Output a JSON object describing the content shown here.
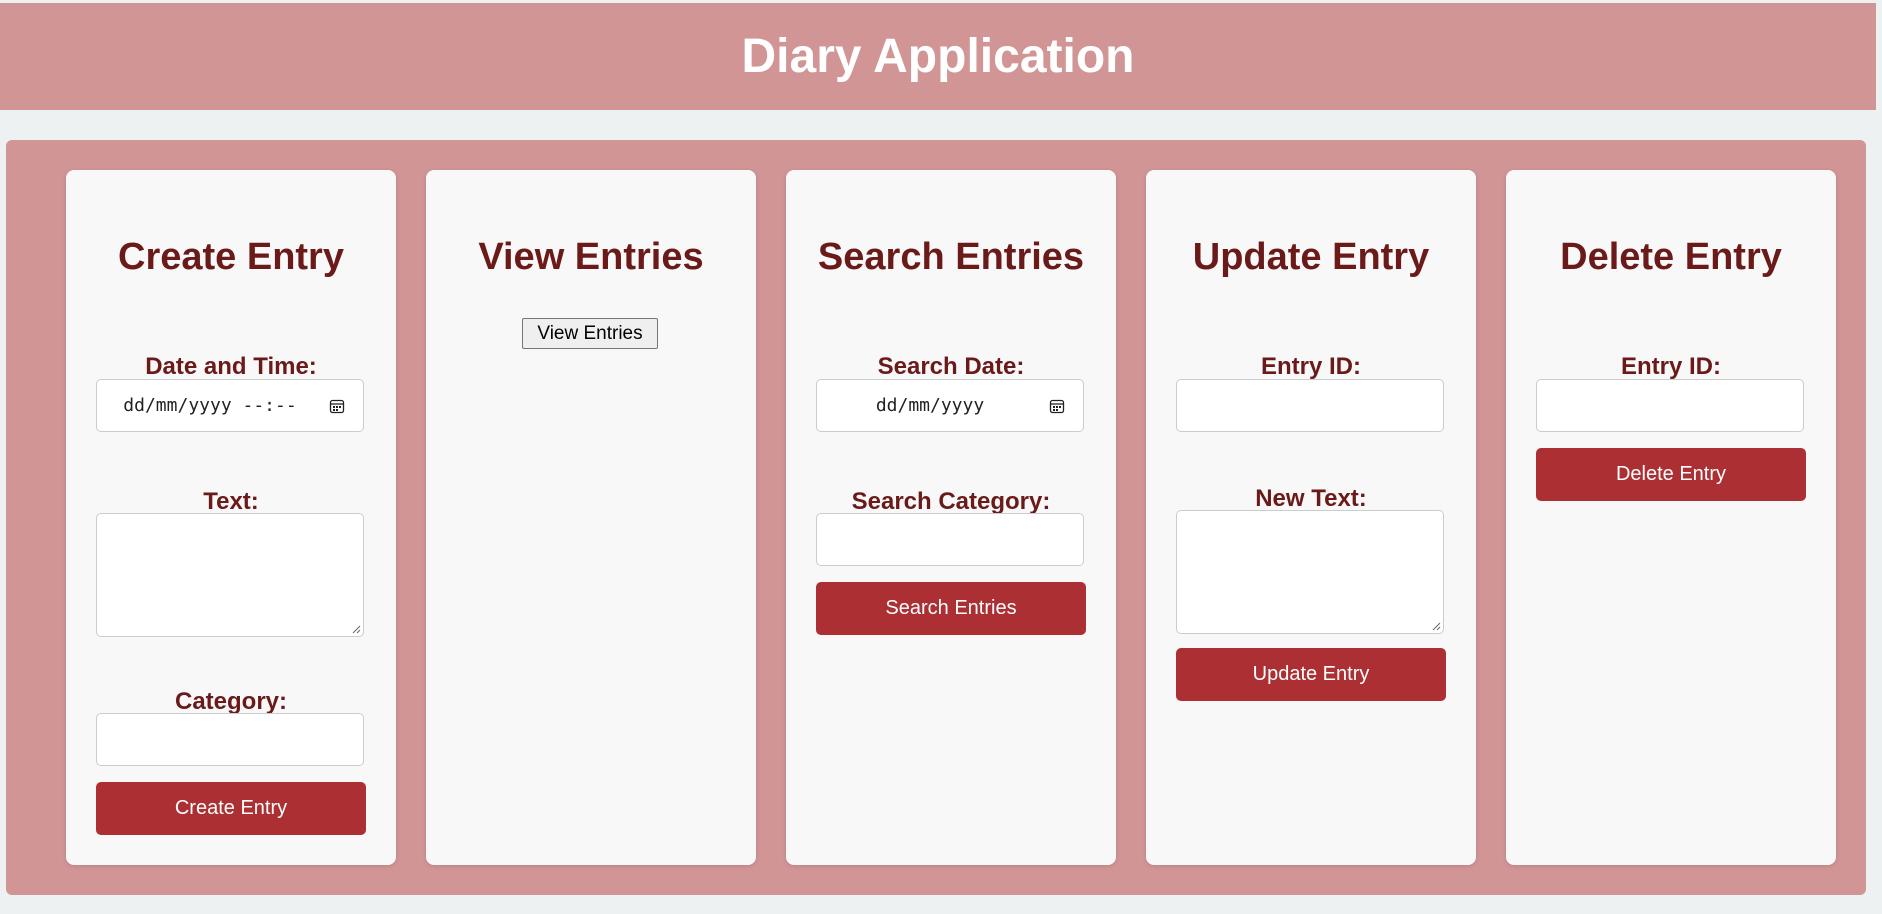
{
  "app": {
    "title": "Diary Application"
  },
  "create": {
    "heading": "Create Entry",
    "datetime_label": "Date and Time:",
    "datetime_placeholder": "dd/mm/yyyy --:--",
    "text_label": "Text:",
    "text_value": "",
    "category_label": "Category:",
    "category_value": "",
    "button": "Create Entry"
  },
  "view": {
    "heading": "View Entries",
    "button": "View Entries"
  },
  "search": {
    "heading": "Search Entries",
    "date_label": "Search Date:",
    "date_placeholder": "dd/mm/yyyy",
    "category_label": "Search Category:",
    "category_value": "",
    "button": "Search Entries"
  },
  "update": {
    "heading": "Update Entry",
    "id_label": "Entry ID:",
    "id_value": "",
    "text_label": "New Text:",
    "text_value": "",
    "button": "Update Entry"
  },
  "delete": {
    "heading": "Delete Entry",
    "id_label": "Entry ID:",
    "id_value": "",
    "button": "Delete Entry"
  },
  "icons": {
    "datetime_picker": "calendar-icon",
    "date_picker": "calendar-icon",
    "textarea_resize": "resize-grip-icon"
  },
  "colors": {
    "header_bg": "#d29596",
    "card_bg": "#f8f8f8",
    "heading_text": "#6b1a1a",
    "button_bg": "#ac3033",
    "button_text": "#ffffff"
  }
}
